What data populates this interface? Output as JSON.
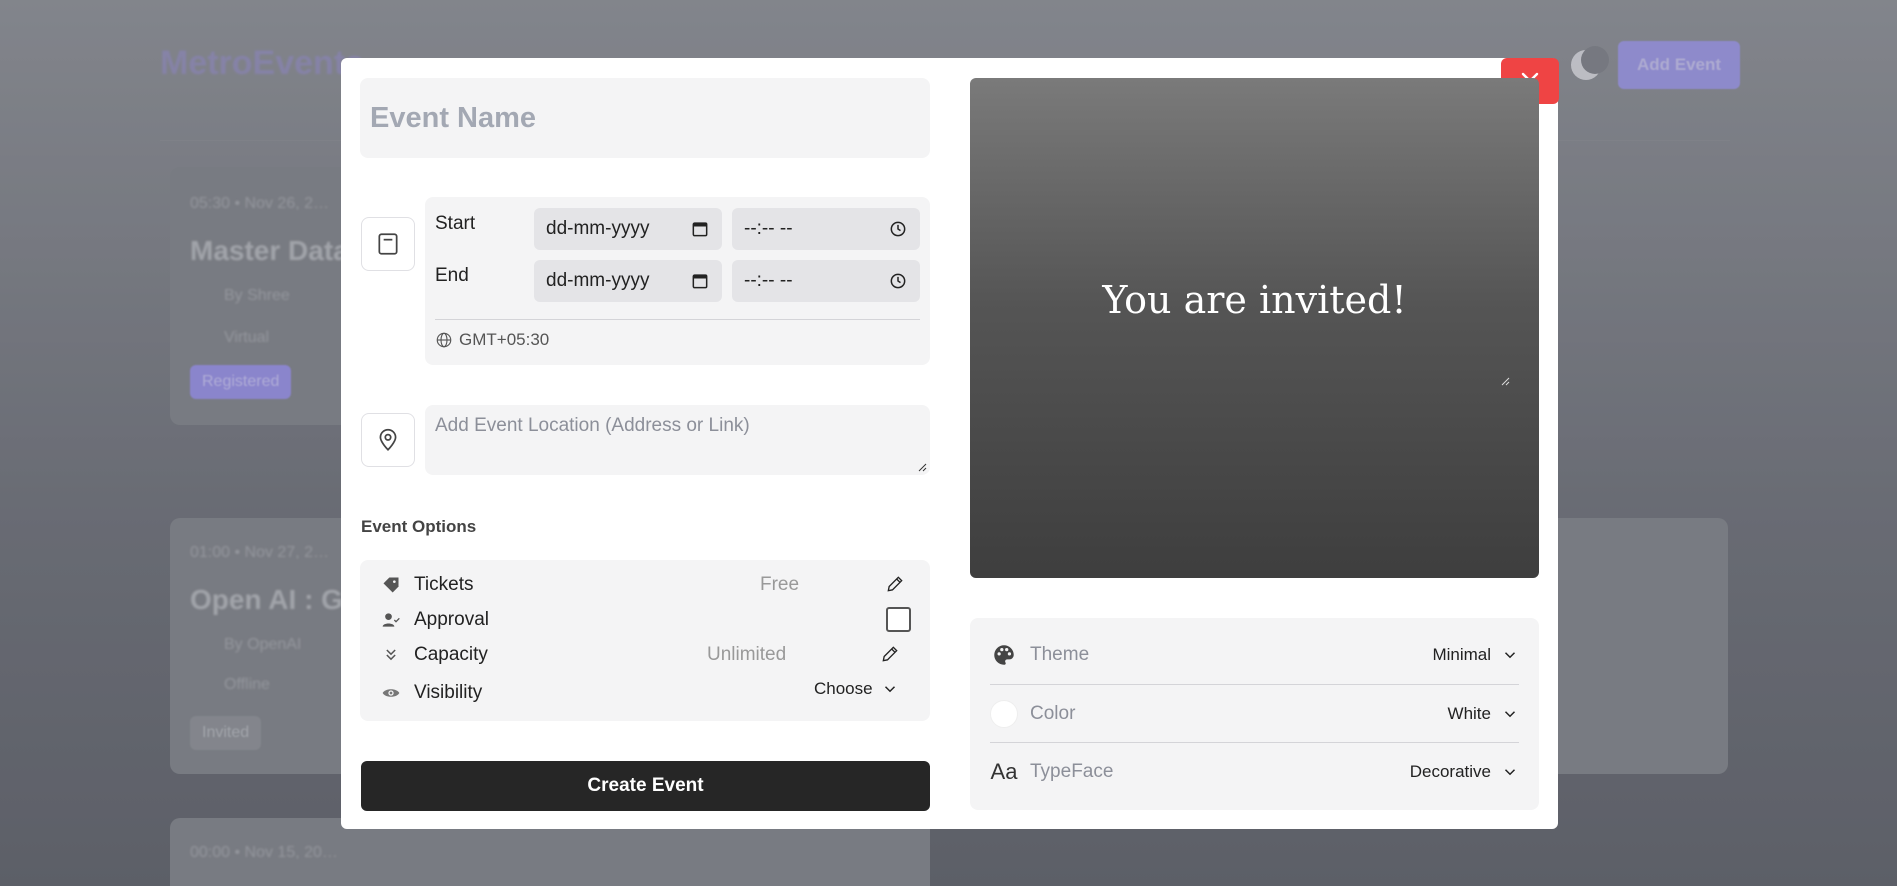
{
  "background": {
    "logo": "MetroEvents",
    "add_event_label": "Add Event",
    "cards": [
      {
        "time": "05:30 • Nov 26, 2…",
        "title": "Master Data…",
        "host": "By Shree",
        "mode": "Virtual",
        "status": "Registered"
      },
      {
        "time": "01:00 • Nov 27, 2…",
        "title": "Open AI : G…",
        "host": "By OpenAI",
        "mode": "Offline",
        "status": "Invited"
      },
      {
        "time": "00:00 • Nov 15, 20…",
        "title": ""
      }
    ]
  },
  "form": {
    "event_name_placeholder": "Event Name",
    "start_label": "Start",
    "end_label": "End",
    "date_placeholder": "dd-mm-yyyy",
    "time_placeholder": "--:-- --",
    "timezone": "GMT+05:30",
    "location_placeholder": "Add Event Location (Address or Link)",
    "options_title": "Event Options",
    "options": {
      "tickets": {
        "label": "Tickets",
        "value": "Free"
      },
      "approval": {
        "label": "Approval",
        "checked": false
      },
      "capacity": {
        "label": "Capacity",
        "value": "Unlimited"
      },
      "visibility": {
        "label": "Visibility",
        "value": "Choose"
      }
    },
    "create_label": "Create Event"
  },
  "preview": {
    "text": "You are invited!"
  },
  "settings": {
    "theme": {
      "label": "Theme",
      "value": "Minimal"
    },
    "color": {
      "label": "Color",
      "value": "White",
      "swatch": "#ffffff"
    },
    "typeface": {
      "label": "TypeFace",
      "value": "Decorative",
      "icon_text": "Aa"
    }
  },
  "colors": {
    "close": "#ef4444",
    "create_button": "#262626",
    "panel": "#f4f4f5"
  }
}
